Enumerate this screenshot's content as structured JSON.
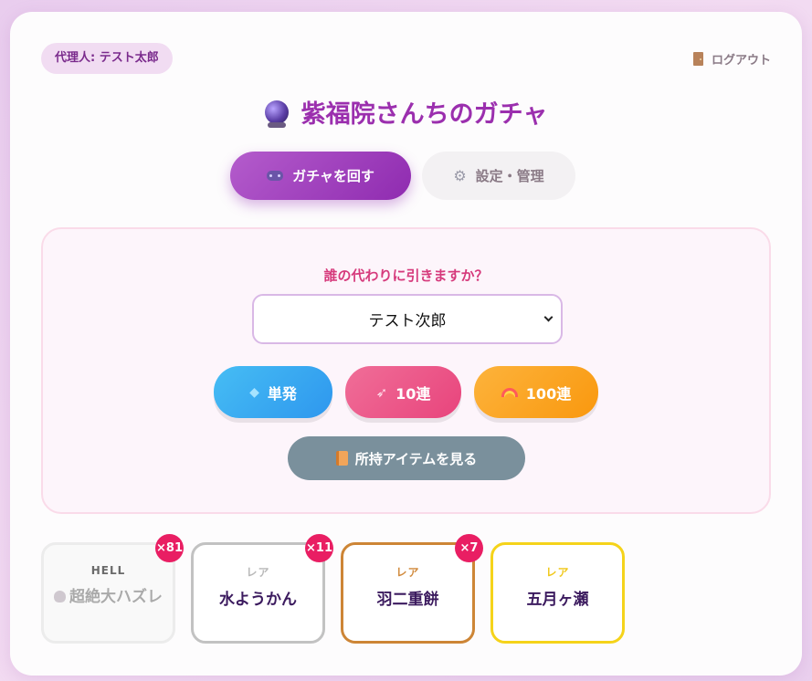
{
  "header": {
    "agent_label": "代理人: テスト太郎",
    "logout_label": "ログアウト",
    "logout_icon": "door-icon"
  },
  "title": {
    "icon": "crystal-ball-icon",
    "text": "紫福院さんちのガチャ"
  },
  "tabs": [
    {
      "label": "ガチャを回す",
      "icon": "gamepad-icon",
      "active": true
    },
    {
      "label": "設定・管理",
      "icon": "gear-icon",
      "active": false
    }
  ],
  "gacha_panel": {
    "prompt": "誰の代わりに引きますか？",
    "selected_user": "テスト次郎",
    "buttons": [
      {
        "label": "単発",
        "icon": "gem-icon",
        "color": "#2e97ee"
      },
      {
        "label": "10連",
        "icon": "rocket-icon",
        "color": "#e8447c"
      },
      {
        "label": "100連",
        "icon": "rainbow-icon",
        "color": "#f9980e"
      }
    ],
    "items_button": {
      "label": "所持アイテムを見る",
      "icon": "book-icon",
      "color": "#7a909c"
    }
  },
  "prizes": [
    {
      "rarity": "HELL",
      "name": "超絶大ハズレ",
      "icon": "skull-icon",
      "count": "×81",
      "border_color": "#ececec"
    },
    {
      "rarity": "レア",
      "name": "水ようかん",
      "count": "×11",
      "border_color": "#c2c2c2"
    },
    {
      "rarity": "レア",
      "name": "羽二重餅",
      "count": "×7",
      "border_color": "#cd8536"
    },
    {
      "rarity": "レア",
      "name": "五月ヶ瀬",
      "count": "",
      "border_color": "#f5d31a"
    }
  ],
  "colors": {
    "accent": "#9b2fae",
    "badge": "#e91e63",
    "prompt": "#d63a7c"
  }
}
